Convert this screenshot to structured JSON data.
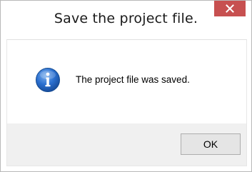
{
  "window": {
    "title": "Save the project file.",
    "close_icon": "close-icon"
  },
  "content": {
    "icon": "info-icon",
    "message": "The project file was saved."
  },
  "footer": {
    "ok_label": "OK"
  },
  "colors": {
    "close_button": "#c75050",
    "info_icon": "#1f5fb4",
    "footer_background": "#f0f0f0",
    "button_background": "#e5e5e5"
  }
}
